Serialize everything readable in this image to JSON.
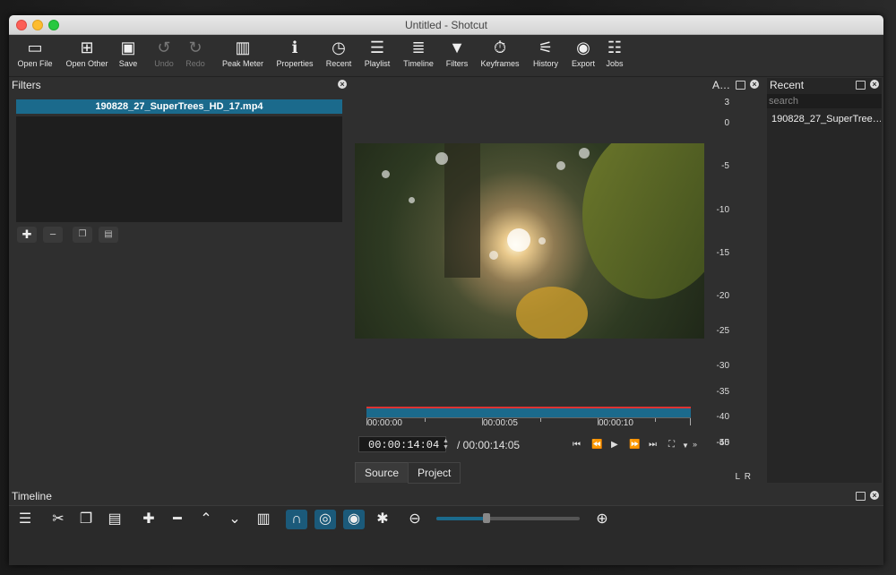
{
  "window": {
    "title": "Untitled - Shotcut"
  },
  "toolbar": {
    "items": [
      {
        "label": "Open File",
        "icon": "folder-icon"
      },
      {
        "label": "Open Other",
        "icon": "open-other-icon"
      },
      {
        "label": "Save",
        "icon": "save-icon"
      },
      {
        "label": "Undo",
        "icon": "undo-icon"
      },
      {
        "label": "Redo",
        "icon": "redo-icon"
      },
      {
        "label": "Peak Meter",
        "icon": "peak-meter-icon"
      },
      {
        "label": "Properties",
        "icon": "info-icon"
      },
      {
        "label": "Recent",
        "icon": "clock-icon"
      },
      {
        "label": "Playlist",
        "icon": "list-icon"
      },
      {
        "label": "Timeline",
        "icon": "timeline-icon"
      },
      {
        "label": "Filters",
        "icon": "funnel-icon"
      },
      {
        "label": "Keyframes",
        "icon": "stopwatch-icon"
      },
      {
        "label": "History",
        "icon": "history-icon"
      },
      {
        "label": "Export",
        "icon": "disc-icon"
      },
      {
        "label": "Jobs",
        "icon": "database-icon"
      }
    ]
  },
  "filters": {
    "title": "Filters",
    "clip": "190828_27_SuperTrees_HD_17.mp4"
  },
  "audio": {
    "title": "A…",
    "scale": [
      "3",
      "0",
      "-5",
      "-10",
      "-15",
      "-20",
      "-25",
      "-30",
      "-35",
      "-40",
      "-45",
      "-50"
    ],
    "channels": [
      "L",
      "R"
    ]
  },
  "recent": {
    "title": "Recent",
    "search_placeholder": "search",
    "items": [
      "190828_27_SuperTree…"
    ]
  },
  "player": {
    "ticks": [
      "00:00:00",
      "00:00:05",
      "00:00:10"
    ],
    "current_time": "00:00:14:04",
    "total_time": "/ 00:00:14:05",
    "tabs": [
      "Source",
      "Project"
    ]
  },
  "timeline": {
    "title": "Timeline"
  }
}
